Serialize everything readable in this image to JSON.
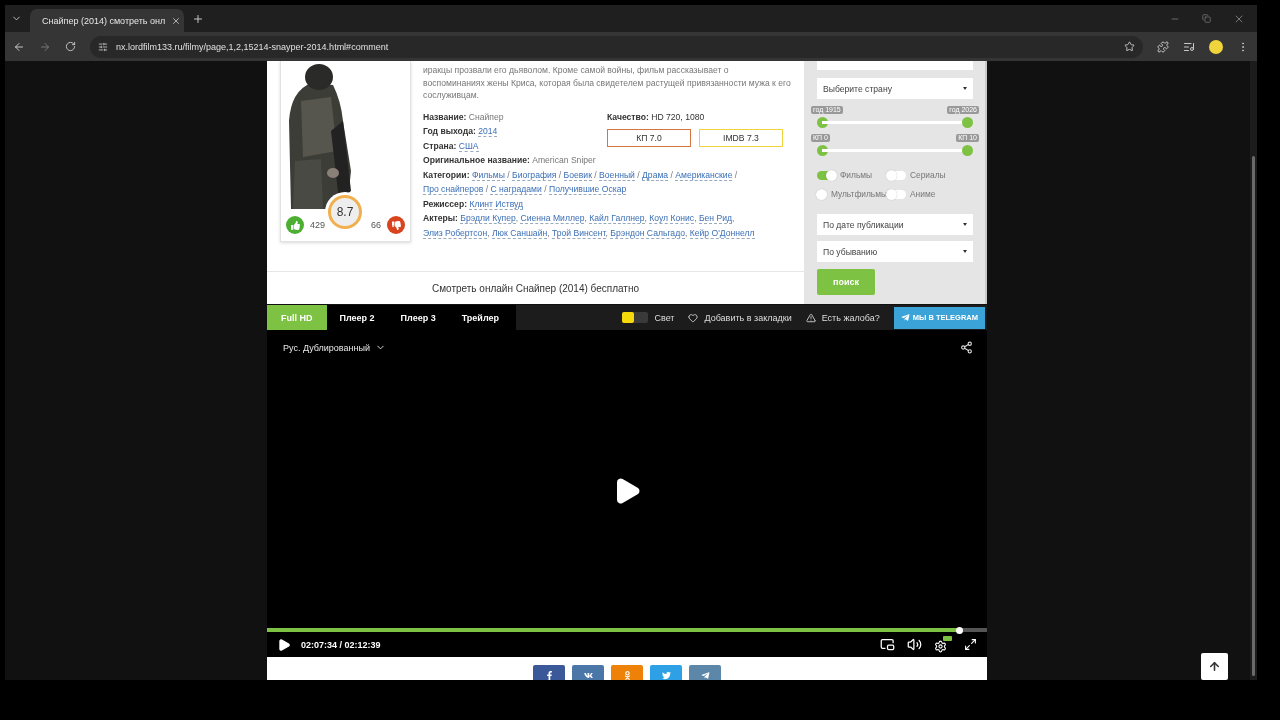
{
  "browser": {
    "tab_title": "Снайпер (2014) смотреть онл",
    "url": "nx.lordfilm133.ru/filmy/page,1,2,15214-snayper-2014.html#comment"
  },
  "movie": {
    "description": "иракцы прозвали его дьяволом. Кроме самой войны, фильм рассказывает о воспоминаниях жены Криса, которая была свидетелем растущей привязанности мужа к его сослуживцам.",
    "rating": "8.7",
    "likes": "429",
    "dislikes": "66",
    "info_left": [
      {
        "label": "Название:",
        "parts": [
          {
            "text": "Снайпер",
            "link": false
          }
        ]
      },
      {
        "label": "Год выхода:",
        "parts": [
          {
            "text": "2014",
            "link": true
          }
        ]
      },
      {
        "label": "Страна:",
        "parts": [
          {
            "text": "США",
            "link": true
          }
        ]
      },
      {
        "label": "Оригинальное название:",
        "parts": [
          {
            "text": "American Sniper",
            "link": false
          }
        ]
      }
    ],
    "quality": {
      "label": "Качество:",
      "value": "HD 720, 1080"
    },
    "scores": [
      {
        "label": "КП 7.0",
        "color": "#d4763f"
      },
      {
        "label": "IMDB 7.3",
        "color": "#f0d43c"
      }
    ],
    "info_rows": [
      {
        "label": "Категории:",
        "parts": [
          {
            "text": "Фильмы",
            "link": true
          },
          {
            "text": " / ",
            "link": false
          },
          {
            "text": "Биография",
            "link": true
          },
          {
            "text": " / ",
            "link": false
          },
          {
            "text": "Боевик",
            "link": true
          },
          {
            "text": " / ",
            "link": false
          },
          {
            "text": "Военный",
            "link": true
          },
          {
            "text": " / ",
            "link": false
          },
          {
            "text": "Драма",
            "link": true
          },
          {
            "text": " / ",
            "link": false
          },
          {
            "text": "Американские",
            "link": true
          },
          {
            "text": " / ",
            "link": false
          },
          {
            "text": "Про снайперов",
            "link": true
          },
          {
            "text": " / ",
            "link": false
          },
          {
            "text": "С наградами",
            "link": true
          },
          {
            "text": " / ",
            "link": false
          },
          {
            "text": "Получившие Оскар",
            "link": true
          }
        ]
      },
      {
        "label": "Режиссер:",
        "parts": [
          {
            "text": "Клинт Иствуд",
            "link": true
          }
        ]
      },
      {
        "label": "Актеры:",
        "parts": [
          {
            "text": "Брэдли Купер",
            "link": true
          },
          {
            "text": ", ",
            "link": false
          },
          {
            "text": "Сиенна Миллер",
            "link": true
          },
          {
            "text": ", ",
            "link": false
          },
          {
            "text": "Кайл Галлнер",
            "link": true
          },
          {
            "text": ", ",
            "link": false
          },
          {
            "text": "Коул Конис",
            "link": true
          },
          {
            "text": ", ",
            "link": false
          },
          {
            "text": "Бен Рид",
            "link": true
          },
          {
            "text": ", ",
            "link": false
          },
          {
            "text": "Элиз Робертсон",
            "link": true
          },
          {
            "text": ", ",
            "link": false
          },
          {
            "text": "Люк Саншайн",
            "link": true
          },
          {
            "text": ", ",
            "link": false
          },
          {
            "text": "Трой Винсент",
            "link": true
          },
          {
            "text": ", ",
            "link": false
          },
          {
            "text": "Брэндон Сальгадо",
            "link": true
          },
          {
            "text": ", ",
            "link": false
          },
          {
            "text": "Кейр О'Доннелл",
            "link": true
          }
        ]
      }
    ],
    "watch_title": "Смотреть онлайн Снайпер (2014) бесплатно"
  },
  "sidebar": {
    "country_select": "Выберите страну",
    "ranges": [
      {
        "min_label": "год 1915",
        "max_label": "год 2026",
        "level": 1
      },
      {
        "min_label": "КП 0",
        "max_label": "КП 10",
        "level": 1
      }
    ],
    "toggles": [
      {
        "label": "Фильмы",
        "on": true
      },
      {
        "label": "Сериалы",
        "on": false
      },
      {
        "label": "Мультфильмы",
        "on": false
      },
      {
        "label": "Аниме",
        "on": false
      }
    ],
    "sort_selects": [
      "По дате публикации",
      "По убыванию"
    ],
    "search_button": "поиск"
  },
  "player": {
    "tabs": [
      {
        "label": "Full HD",
        "selected": true
      },
      {
        "label": "Плеер 2",
        "selected": false
      },
      {
        "label": "Плеер 3",
        "selected": false
      },
      {
        "label": "Трейлер",
        "selected": false
      }
    ],
    "light": {
      "label": "Свет",
      "on": false
    },
    "bookmark": "Добавить в закладки",
    "complaint": "Есть жалоба?",
    "telegram": "МЫ В TELEGRAM",
    "audio": "Рус. Дублированный",
    "time": "02:07:34 / 02:12:39",
    "progress": {
      "level": 0.963
    },
    "share": [
      {
        "kind": "facebook",
        "color": "#3b5998"
      },
      {
        "kind": "vk",
        "color": "#4a76a8"
      },
      {
        "kind": "ok",
        "color": "#ee8208"
      },
      {
        "kind": "twitter",
        "color": "#2ea1e6"
      },
      {
        "kind": "telegram",
        "color": "#5d87a8"
      }
    ]
  }
}
